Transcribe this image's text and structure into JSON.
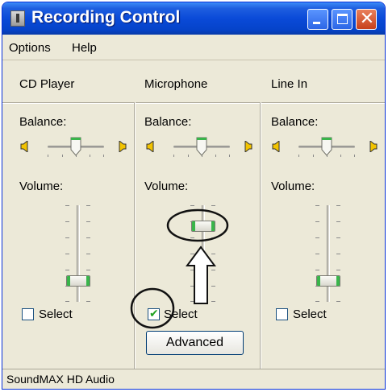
{
  "window": {
    "title": "Recording Control",
    "icon": "speaker-app-icon"
  },
  "menu": {
    "items": [
      "Options",
      "Help"
    ]
  },
  "channels": [
    {
      "name": "CD Player",
      "balance_label": "Balance:",
      "volume_label": "Volume:",
      "select_label": "Select",
      "selected": false,
      "volume_level": 0.1,
      "balance_level": 0.5
    },
    {
      "name": "Microphone",
      "balance_label": "Balance:",
      "volume_label": "Volume:",
      "select_label": "Select",
      "selected": true,
      "volume_level": 0.75,
      "balance_level": 0.5,
      "advanced_label": "Advanced"
    },
    {
      "name": "Line In",
      "balance_label": "Balance:",
      "volume_label": "Volume:",
      "select_label": "Select",
      "selected": false,
      "volume_level": 0.1,
      "balance_level": 0.5
    }
  ],
  "status": {
    "text": "SoundMAX HD Audio"
  },
  "colors": {
    "title_bar": "#0a4ad8",
    "window_bg": "#ece9d8",
    "accent_green": "#39b54a",
    "close_button": "#c7401c"
  }
}
